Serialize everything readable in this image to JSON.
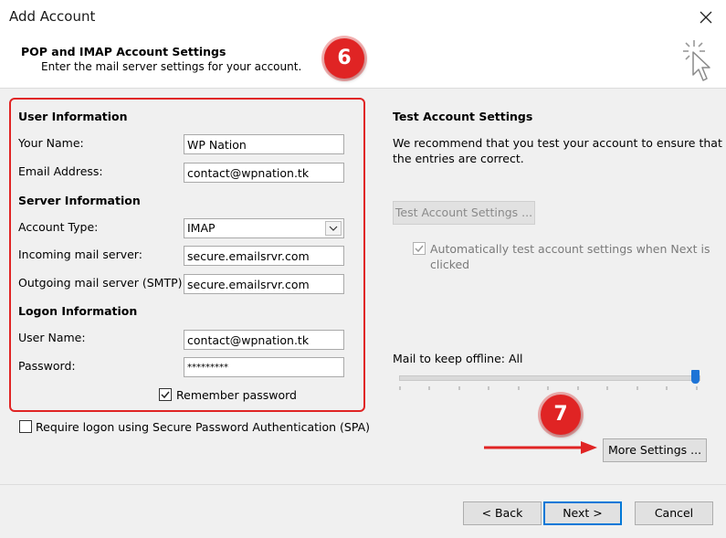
{
  "window": {
    "title": "Add Account"
  },
  "header": {
    "title": "POP and IMAP Account Settings",
    "subtitle": "Enter the mail server settings for your account."
  },
  "annotations": {
    "step6": "6",
    "step7": "7",
    "accent": "#e02424"
  },
  "user_info": {
    "heading": "User Information",
    "name_label": "Your Name:",
    "name_value": "WP Nation",
    "email_label": "Email Address:",
    "email_value": "contact@wpnation.tk"
  },
  "server_info": {
    "heading": "Server Information",
    "account_type_label": "Account Type:",
    "account_type_value": "IMAP",
    "incoming_label": "Incoming mail server:",
    "incoming_value": "secure.emailsrvr.com",
    "outgoing_label": "Outgoing mail server (SMTP):",
    "outgoing_value": "secure.emailsrvr.com"
  },
  "logon_info": {
    "heading": "Logon Information",
    "username_label": "User Name:",
    "username_value": "contact@wpnation.tk",
    "password_label": "Password:",
    "password_value": "*********",
    "remember_label": "Remember password",
    "remember_checked": true,
    "spa_label": "Require logon using Secure Password Authentication (SPA)",
    "spa_checked": false
  },
  "test_settings": {
    "heading": "Test Account Settings",
    "description_line1": "We recommend that you test your account to ensure that",
    "description_line2": "the entries are correct.",
    "test_button": "Test Account Settings ...",
    "auto_test_line1": "Automatically test account settings when Next is",
    "auto_test_line2": "clicked",
    "auto_test_checked": true
  },
  "offline": {
    "label": "Mail to keep offline:",
    "value": "All",
    "slider_level": 1.0
  },
  "buttons": {
    "more_settings": "More Settings ...",
    "back": "< Back",
    "next": "Next >",
    "cancel": "Cancel"
  }
}
